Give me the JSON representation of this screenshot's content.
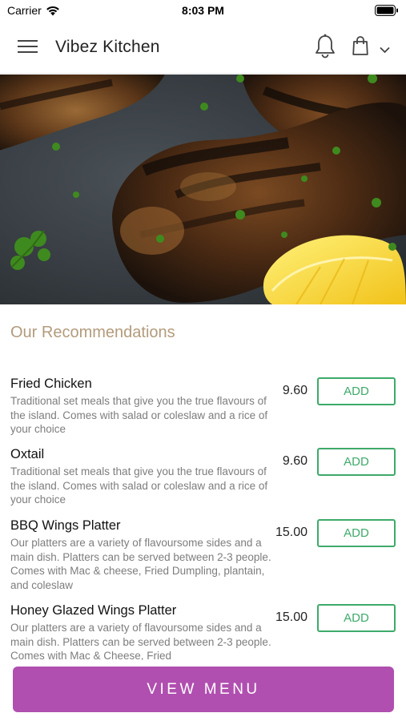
{
  "status_bar": {
    "carrier": "Carrier",
    "time": "8:03 PM"
  },
  "header": {
    "title": "Vibez Kitchen",
    "icons": [
      "hamburger-menu-icon",
      "bell-icon",
      "shopping-bag-icon",
      "chevron-down-icon"
    ]
  },
  "hero": {
    "image": "grilled-chicken-drumsticks-photo"
  },
  "section": {
    "title": "Our Recommendations"
  },
  "items": [
    {
      "name": "Fried Chicken",
      "description": "Traditional set meals that give you the true flavours of the island. Comes with salad or coleslaw and a rice of your choice",
      "price": "9.60",
      "button": "ADD"
    },
    {
      "name": "Oxtail",
      "description": "Traditional set meals that give you the true flavours of the island. Comes with salad or coleslaw and a rice of your choice",
      "price": "9.60",
      "button": "ADD"
    },
    {
      "name": "BBQ Wings Platter",
      "description": "Our platters are a variety of flavoursome sides and a main dish. Platters can be served between 2-3 people. Comes with Mac & cheese, Fried Dumpling, plantain, and coleslaw",
      "price": "15.00",
      "button": "ADD"
    },
    {
      "name": "Honey Glazed Wings Platter",
      "description": "Our platters are a variety of flavoursome sides and a main dish. Platters can be served between 2-3 people. Comes with Mac & Cheese, Fried",
      "price": "15.00",
      "button": "ADD"
    }
  ],
  "footer": {
    "view_menu_label": "VIEW MENU"
  },
  "colors": {
    "accent_purple": "#b04fb0",
    "add_green": "#3eaa6a",
    "section_title_tan": "#b39b7c",
    "description_gray": "#7d7d7d"
  }
}
